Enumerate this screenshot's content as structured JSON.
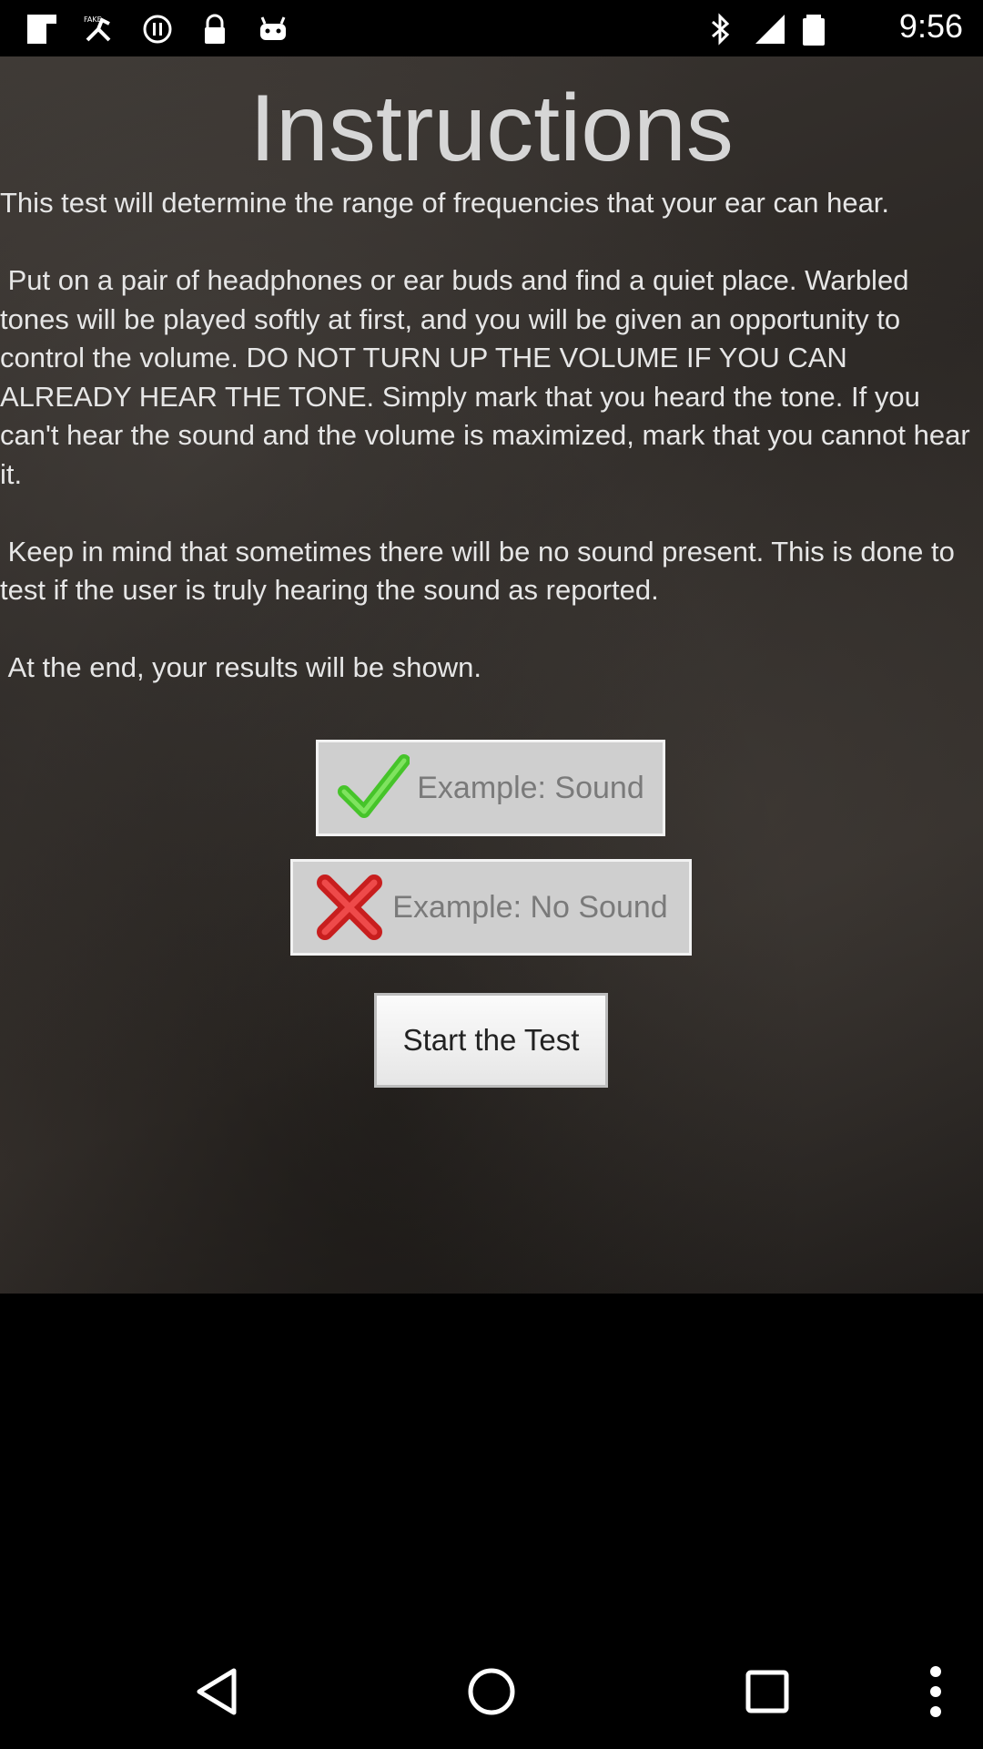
{
  "status_bar": {
    "time": "9:56",
    "left_icons": [
      "flipboard-icon",
      "fake-gps-icon",
      "record-icon",
      "lock-icon",
      "android-icon"
    ],
    "right_icons": [
      "bluetooth-icon",
      "signal-icon",
      "battery-icon"
    ]
  },
  "page": {
    "title": "Instructions",
    "paragraphs": [
      "This test will determine the range of frequencies that your ear can hear.",
      " Put on a pair of headphones or ear buds and find a quiet place. Warbled tones will be played softly at first, and you will be given an opportunity to control the volume. DO NOT TURN UP THE VOLUME IF YOU CAN ALREADY HEAR THE TONE. Simply mark that you heard the tone. If you can't hear the sound and the volume is maximized, mark that you cannot hear it.",
      " Keep in mind that sometimes there will be no sound present. This is done to test if the user is truly hearing the sound as reported.",
      " At the end, your results will be shown."
    ],
    "example_sound_label": "Example: Sound",
    "example_no_sound_label": "Example: No Sound",
    "start_button_label": "Start the Test"
  },
  "nav_bar": {
    "buttons": [
      "back-icon",
      "home-icon",
      "recents-icon",
      "more-options-icon"
    ]
  },
  "colors": {
    "check": "#46c42a",
    "cross": "#e02a2a"
  }
}
